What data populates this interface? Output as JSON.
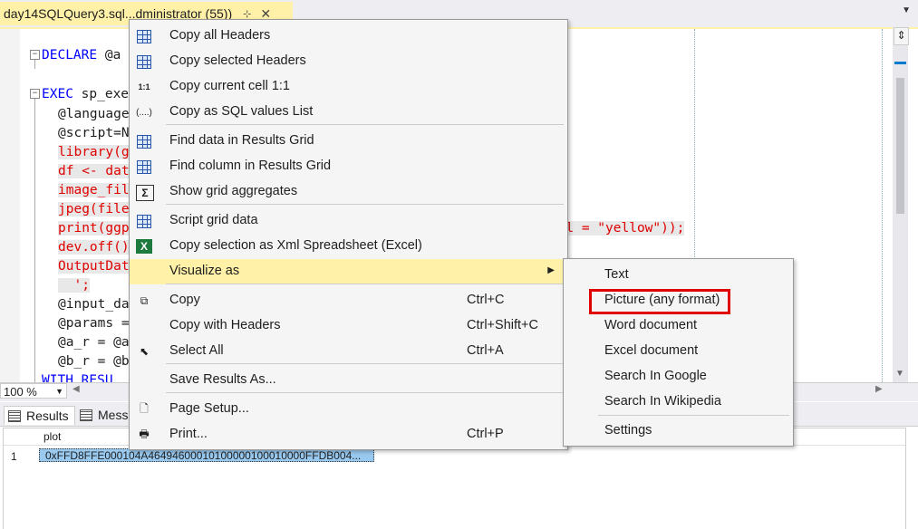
{
  "tab": {
    "title": "day14SQLQuery3.sql...dministrator (55))",
    "pin": "⊹",
    "close": "✕"
  },
  "editor": {
    "lines": [
      {
        "kw": "DECLARE",
        "rest": " @a"
      },
      {
        "kw": "EXEC",
        "rest": " sp_exe"
      },
      {
        "text": "@language"
      },
      {
        "text": "@script=N"
      },
      {
        "str": "library(g"
      },
      {
        "str": "df <- dat",
        "tail": "));"
      },
      {
        "str": "image_fil"
      },
      {
        "str": "jpeg(file"
      },
      {
        "str": "print(ggp",
        "tail": "\", fill = \"yellow\"));"
      },
      {
        "str": "dev.off()"
      },
      {
        "str": "OutputDat"
      },
      {
        "str": "  ';"
      },
      {
        "text": "@input_da"
      },
      {
        "text": "@params ="
      },
      {
        "text": "@a_r = @a"
      },
      {
        "text": "@b_r = @b"
      },
      {
        "kw": "WITH RESU"
      }
    ]
  },
  "zoom": {
    "value": "100 %"
  },
  "results_tabs": {
    "results": "Results",
    "messages": "Mess"
  },
  "grid": {
    "column": "plot",
    "row_number": "1",
    "cell_value": "0xFFD8FFE000104A46494600010100000100010000FFDB004..."
  },
  "context_menu": {
    "items": [
      {
        "icon": "grid-all-icon",
        "label": "Copy all Headers"
      },
      {
        "icon": "grid-selected-icon",
        "label": "Copy selected Headers"
      },
      {
        "icon": "cell-icon",
        "glyph": "1:1",
        "label": "Copy current cell 1:1"
      },
      {
        "icon": "sql-values-icon",
        "glyph": "(....)",
        "label": "Copy as SQL values List"
      },
      {
        "icon": "find-data-icon",
        "label": "Find data in Results Grid"
      },
      {
        "icon": "find-column-icon",
        "label": "Find column in Results Grid"
      },
      {
        "icon": "sigma-icon",
        "glyph": "Σ",
        "label": "Show grid aggregates"
      },
      {
        "icon": "script-icon",
        "label": "Script grid data"
      },
      {
        "icon": "excel-icon",
        "glyph": "X",
        "label": "Copy selection as Xml Spreadsheet (Excel)"
      },
      {
        "icon": "",
        "label": "Visualize as",
        "submenu_arrow": "▶"
      },
      {
        "icon": "copy-icon",
        "glyph": "⧉",
        "label": "Copy",
        "shortcut": "Ctrl+C"
      },
      {
        "icon": "",
        "label": "Copy with Headers",
        "shortcut": "Ctrl+Shift+C"
      },
      {
        "icon": "select-all-icon",
        "glyph": "⬉",
        "label": "Select All",
        "shortcut": "Ctrl+A"
      },
      {
        "icon": "",
        "label": "Save Results As..."
      },
      {
        "icon": "page-setup-icon",
        "glyph": "🗋",
        "label": "Page Setup..."
      },
      {
        "icon": "printer-icon",
        "glyph": "🖶",
        "label": "Print...",
        "shortcut": "Ctrl+P"
      }
    ]
  },
  "submenu": {
    "items": [
      "Text",
      "Picture (any format)",
      "Word document",
      "Excel document",
      "Search In Google",
      "Search In Wikipedia",
      "Settings"
    ]
  },
  "colors": {
    "accent": "#007acc",
    "tab_highlight": "#fff1a8",
    "annotation": "#e00000",
    "cell_selected": "#99c9ef"
  }
}
